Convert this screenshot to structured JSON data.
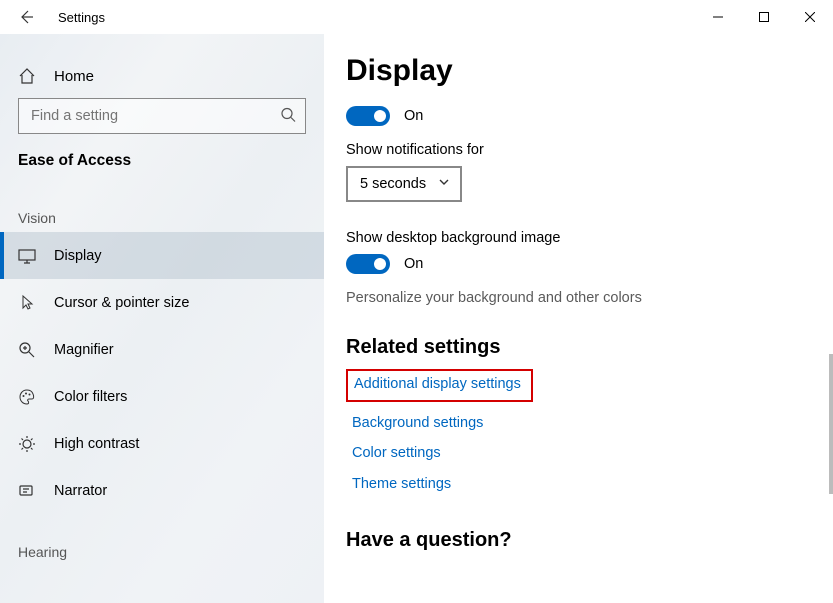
{
  "window": {
    "title": "Settings"
  },
  "sidebar": {
    "home_label": "Home",
    "search_placeholder": "Find a setting",
    "section_header": "Ease of Access",
    "group_vision": "Vision",
    "group_hearing": "Hearing",
    "items": [
      {
        "label": "Display"
      },
      {
        "label": "Cursor & pointer size"
      },
      {
        "label": "Magnifier"
      },
      {
        "label": "Color filters"
      },
      {
        "label": "High contrast"
      },
      {
        "label": "Narrator"
      }
    ]
  },
  "content": {
    "page_title": "Display",
    "toggle1_label": "On",
    "notifications_label": "Show notifications for",
    "notifications_value": "5 seconds",
    "desktop_bg_label": "Show desktop background image",
    "toggle2_label": "On",
    "personalize_text": "Personalize your background and other colors",
    "related_heading": "Related settings",
    "links": [
      "Additional display settings",
      "Background settings",
      "Color settings",
      "Theme settings"
    ],
    "question_heading": "Have a question?"
  }
}
